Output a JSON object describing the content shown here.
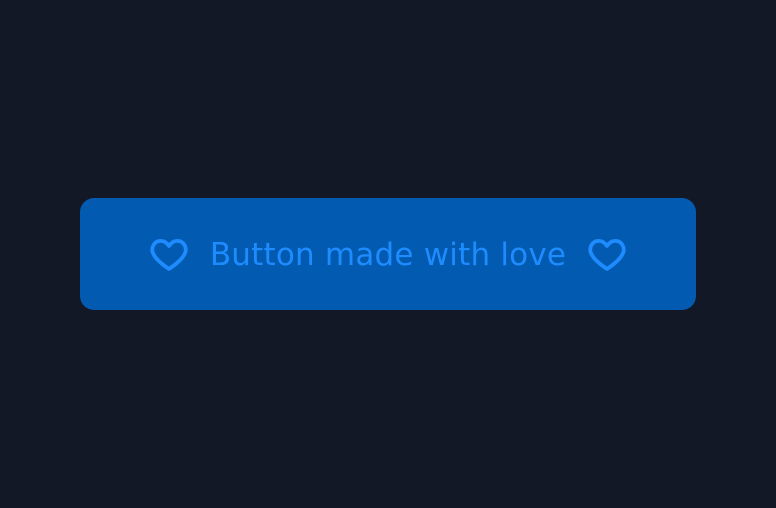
{
  "button": {
    "label": "Button made with love",
    "leading_icon": "heart-icon",
    "trailing_icon": "heart-icon"
  },
  "colors": {
    "background": "#131826",
    "button_background": "#025bb0",
    "accent": "#1e8bff"
  }
}
